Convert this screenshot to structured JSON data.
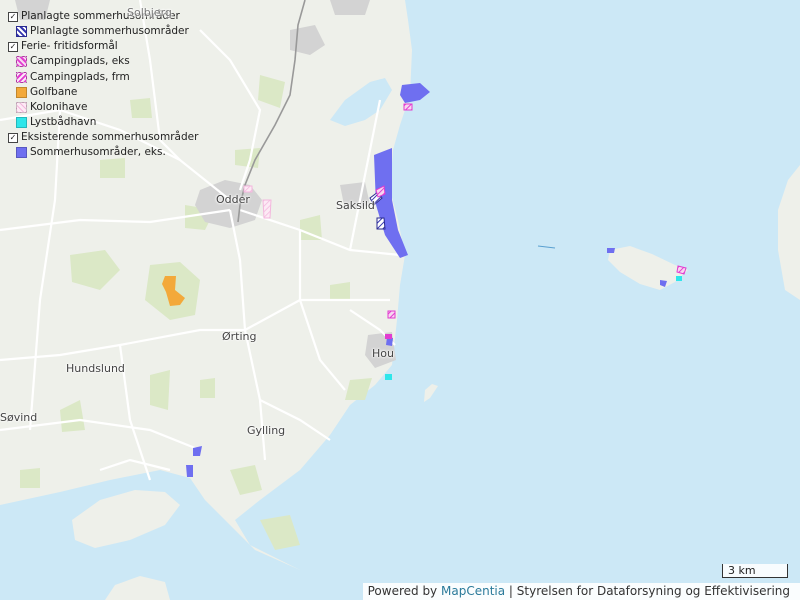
{
  "colors": {
    "land": "#eef0ea",
    "sea": "#cce8f6",
    "forest": "#dbe8c6",
    "town": "#d3d3d3",
    "road": "#ffffff",
    "sommerhus": "#6f6ff0",
    "camping": "#e23cd0",
    "golf": "#f3a93a",
    "koloni": "#f3b7dd",
    "baadhavn": "#2ee6ea"
  },
  "legend": {
    "group1": "Planlagte sommerhusområder",
    "group1_item": "Planlagte sommerhusområder",
    "group2": "Ferie- fritidsformål",
    "group2_items": [
      "Campingplads, eks",
      "Campingplads, frm",
      "Golfbane",
      "Kolonihave",
      "Lystbådhavn"
    ],
    "group3": "Eksisterende sommerhusområder",
    "group3_item": "Sommerhusområder, eks."
  },
  "places": {
    "solbjerg": "Solbjerg",
    "odder": "Odder",
    "saksild": "Saksild",
    "orting": "Ørting",
    "hou": "Hou",
    "hundslund": "Hundslund",
    "sovind": "Søvind",
    "gylling": "Gylling"
  },
  "scale": {
    "label": "3 km"
  },
  "attribution": {
    "prefix": "Powered by",
    "brand": "MapCentia",
    "source": "| Styrelsen for Dataforsyning og Effektivisering"
  }
}
